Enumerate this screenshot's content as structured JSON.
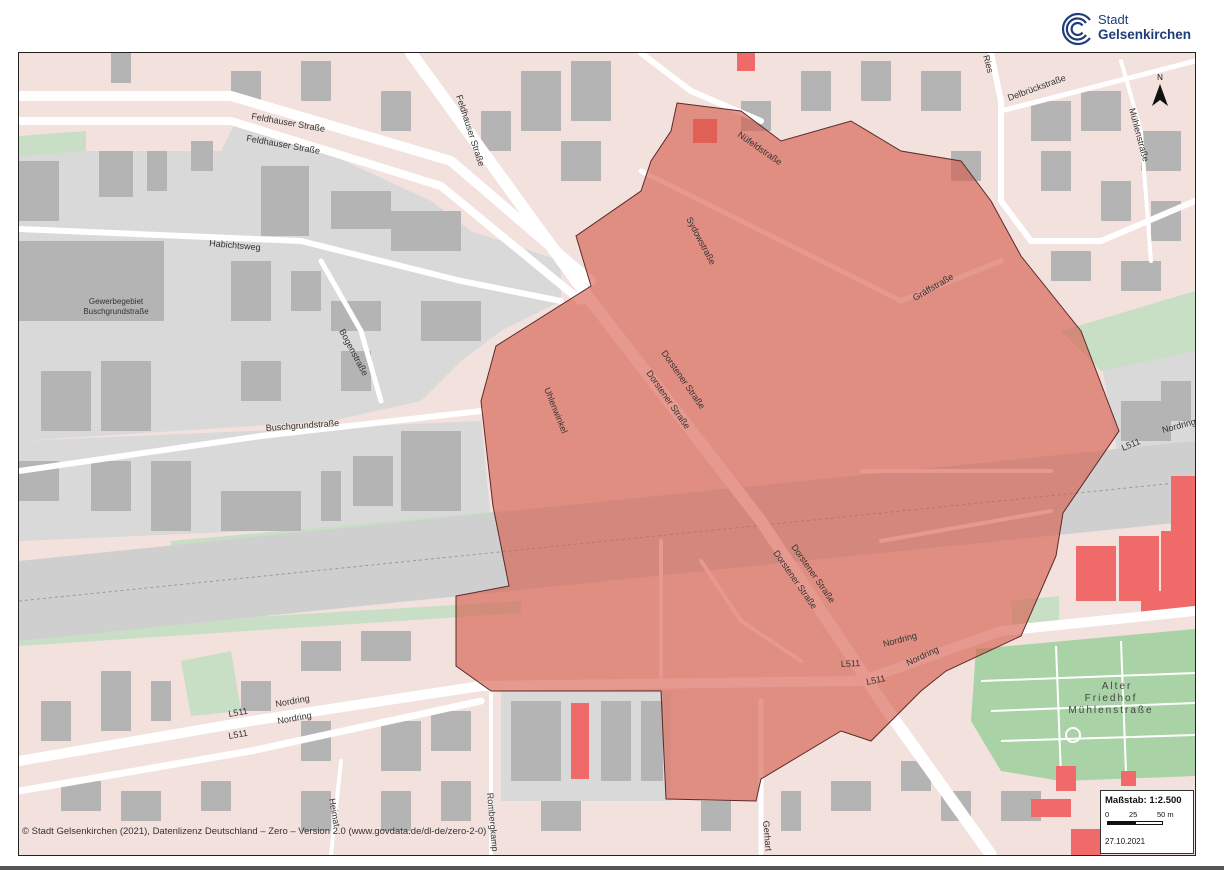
{
  "header": {
    "logo_line1": "Stadt",
    "logo_line2": "Gelsenkirchen"
  },
  "map": {
    "street_labels": {
      "feldhauser1": "Feldhauser Straße",
      "feldhauser2": "Feldhauser Straße",
      "habichtsweg": "Habichtsweg",
      "gewerbe1": "Gewerbegebiet",
      "gewerbe2": "Buschgrundstraße",
      "bogenstrasse": "Bogenstraße",
      "buschgrund": "Buschgrundstraße",
      "uhlenwinkel": "Uhlenwinkel",
      "dorstener1": "Dorstener Straße",
      "dorstener2": "Dorstener Straße",
      "dorstener3": "Dorstener Straße",
      "dorstener4": "Dorstener Straße",
      "nordring1": "Nordring",
      "nordring2": "Nordring",
      "nordring3": "Nordring",
      "nordring4": "Nordring",
      "nordring5": "Nordring",
      "l511a": "L511",
      "l511b": "L511",
      "l511c": "L511",
      "l511d": "L511",
      "l511e": "L511",
      "sydowstrasse": "Sydowstraße",
      "nuefeld": "Nüfeldstraße",
      "graffstrasse": "Gräffstraße",
      "delbrueck": "Delbrückstraße",
      "muehlen": "Mühlenstraße",
      "feldhauser_north": "Feldhauser Straße",
      "heimat": "Heimat",
      "romberg": "Rombergkamp",
      "gerhart": "Gerhart",
      "friedhof1": "Alter",
      "friedhof2": "Friedhof",
      "friedhof3": "Mühlenstraße",
      "ries": "Ries"
    },
    "north_label": "N",
    "colors": {
      "residential": "#f2e1dd",
      "industrial": "#d9d9d9",
      "building": "#b4b4b4",
      "road": "#ffffff",
      "green": "#c8dfc6",
      "cemetery": "#a9d3a6",
      "rail": "#cfcfcf",
      "highlight_area": "#d65a4a",
      "public_building": "#f06a6a"
    }
  },
  "scale": {
    "title": "Maßstab: 1:2.500",
    "tick_0": "0",
    "tick_25": "25",
    "tick_50": "50 m",
    "date": "27.10.2021"
  },
  "footer": {
    "copyright": "© Stadt Gelsenkirchen (2021), Datenlizenz Deutschland – Zero – Version 2.0 (www.govdata.de/dl-de/zero-2-0)"
  }
}
